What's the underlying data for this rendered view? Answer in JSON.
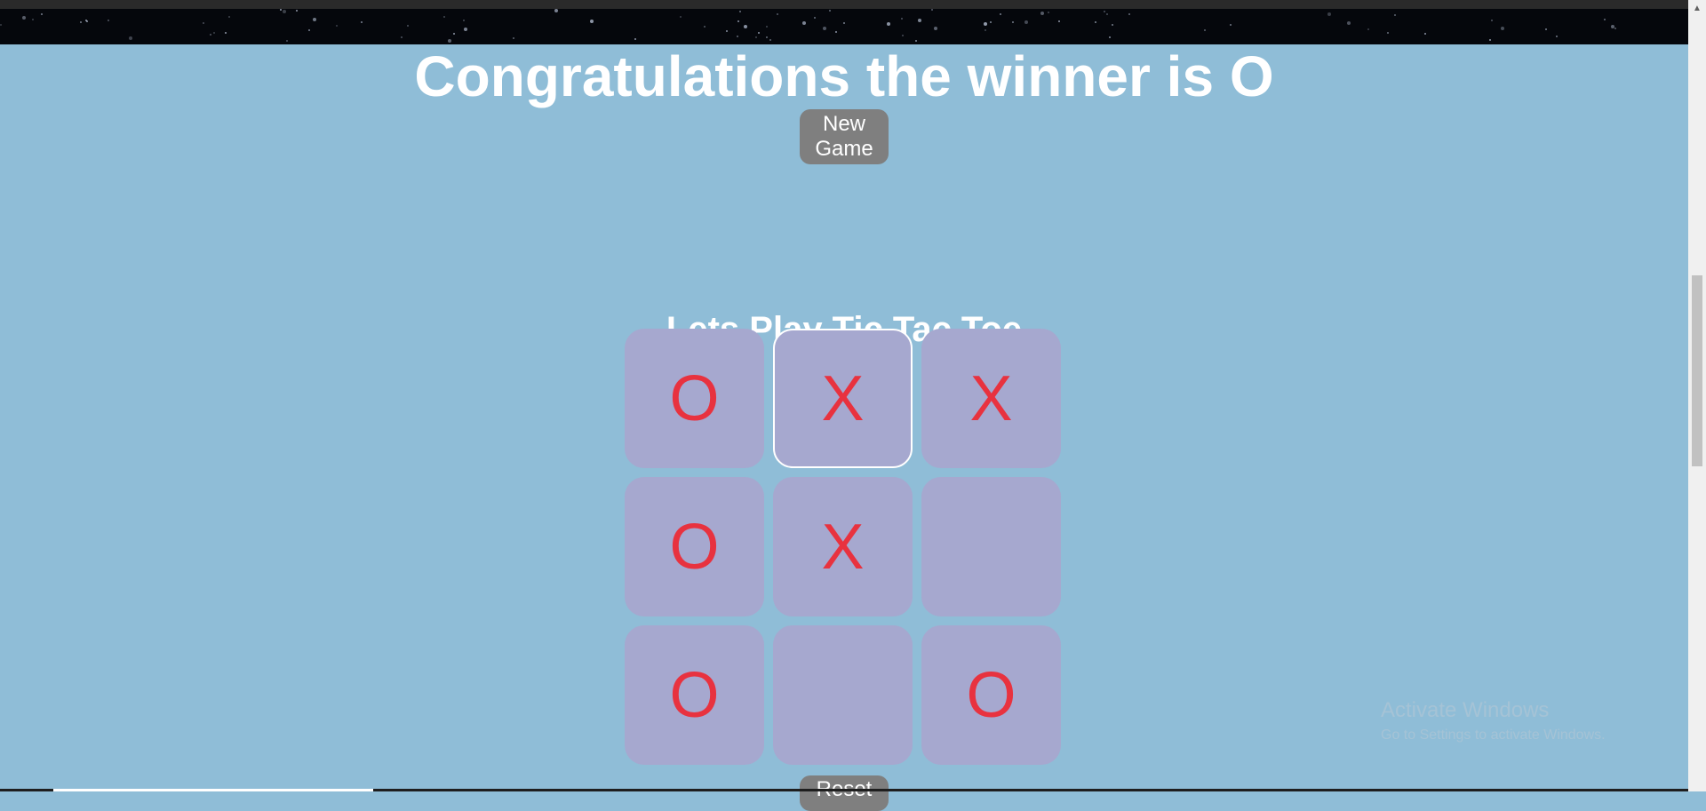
{
  "banner": {
    "text": "Congratulations the winner is O"
  },
  "new_game_button": {
    "line1": "New",
    "line2": "Game"
  },
  "game": {
    "title": "Lets Play Tic Tac Toe",
    "board": [
      "O",
      "X",
      "X",
      "O",
      "X",
      "",
      "O",
      "",
      "O"
    ],
    "focused_cell": 1
  },
  "reset_button": {
    "label": "Reset"
  },
  "watermark": {
    "line1": "Activate Windows",
    "line2": "Go to Settings to activate Windows."
  },
  "colors": {
    "page_background": "#8fbdd7",
    "cell_background": "#a6a8cf",
    "mark_color": "#e8323f",
    "button_background": "#7f7f7f"
  }
}
